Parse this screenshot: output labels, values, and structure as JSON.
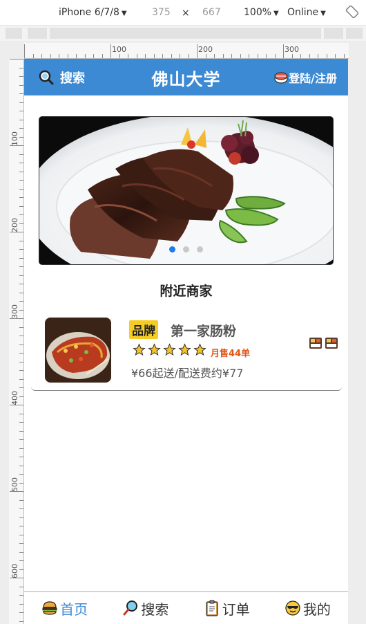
{
  "devtools": {
    "device": "iPhone 6/7/8",
    "width": "375",
    "times": "×",
    "height": "667",
    "zoom": "100%",
    "network": "Online"
  },
  "rulers": {
    "h_labels": [
      "100",
      "200",
      "300"
    ],
    "v_labels": [
      "100",
      "200",
      "300",
      "400",
      "500",
      "600"
    ]
  },
  "header": {
    "search_label": "搜索",
    "title": "佛山大学",
    "login_label": "登陆/注册"
  },
  "banner": {
    "image": "grilled-steak-plate",
    "dots": 3,
    "active_dot": 0
  },
  "nearby": {
    "title": "附近商家",
    "shops": [
      {
        "tag": "品牌",
        "name": "第一家肠粉",
        "rating": 5,
        "monthly_sales": "月售44单",
        "price_info": "¥66起送/配送费约¥77",
        "thumb": "spicy-fish-dish"
      }
    ]
  },
  "tabs": [
    {
      "label": "首页",
      "icon": "burger-icon",
      "active": true
    },
    {
      "label": "搜索",
      "icon": "magnifier-icon",
      "active": false
    },
    {
      "label": "订单",
      "icon": "clipboard-icon",
      "active": false
    },
    {
      "label": "我的",
      "icon": "sunglasses-face-icon",
      "active": false
    }
  ],
  "colors": {
    "header_bg": "#3d8ad4",
    "brand_tag": "#f6cc24",
    "sales_text": "#e0561b",
    "active_dot": "#1e7ce8"
  }
}
